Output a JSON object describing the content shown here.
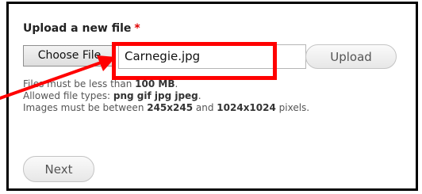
{
  "form": {
    "label": "Upload a new file",
    "required_marker": "*",
    "choose_file_label": "Choose File",
    "file_name": "Carnegie.jpg",
    "upload_label": "Upload",
    "help": {
      "size_prefix": "Files must be less than ",
      "size_value": "100 MB",
      "size_suffix": ".",
      "types_prefix": "Allowed file types: ",
      "types_value": "png gif jpg jpeg",
      "types_suffix": ".",
      "dims_prefix": "Images must be between ",
      "dims_min": "245x245",
      "dims_and": " and ",
      "dims_max": "1024x1024",
      "dims_suffix": " pixels."
    },
    "next_label": "Next"
  },
  "colors": {
    "highlight": "#ff0000",
    "required": "#e00000",
    "frame": "#000000"
  },
  "annotation": {
    "icon": "red-arrow-icon"
  }
}
